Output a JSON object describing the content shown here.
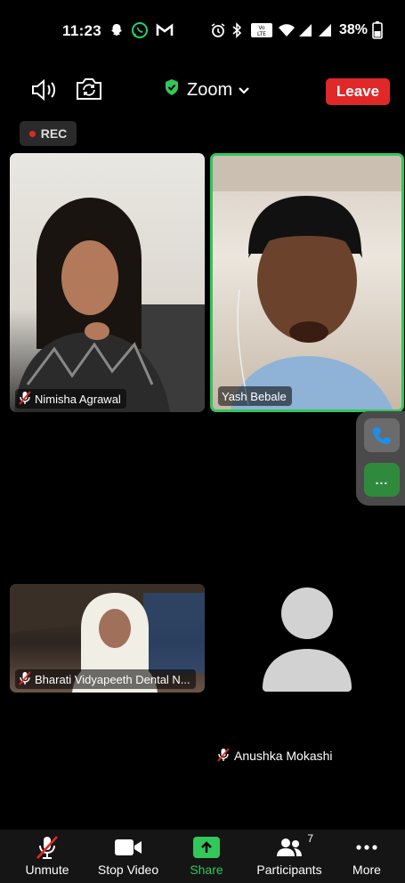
{
  "status_bar": {
    "time": "11:23",
    "battery": "38%",
    "network_label": "Vo LTE"
  },
  "top_bar": {
    "meeting_title": "Zoom",
    "leave_label": "Leave"
  },
  "recording": {
    "label": "REC"
  },
  "participants": {
    "tile1_name": "Nimisha Agrawal",
    "tile2_name": "Yash Bebale",
    "tile3_name": "Bharati Vidyapeeth Dental N...",
    "tile4_name": "Anushka Mokashi"
  },
  "floating_tools": {
    "more_label": "..."
  },
  "toolbar": {
    "unmute_label": "Unmute",
    "stop_video_label": "Stop Video",
    "share_label": "Share",
    "participants_label": "Participants",
    "participants_count": "7",
    "more_label": "More"
  },
  "colors": {
    "leave_red": "#e02828",
    "active_speaker_green": "#33c65a",
    "share_green": "#33c65a",
    "background": "#000000"
  }
}
